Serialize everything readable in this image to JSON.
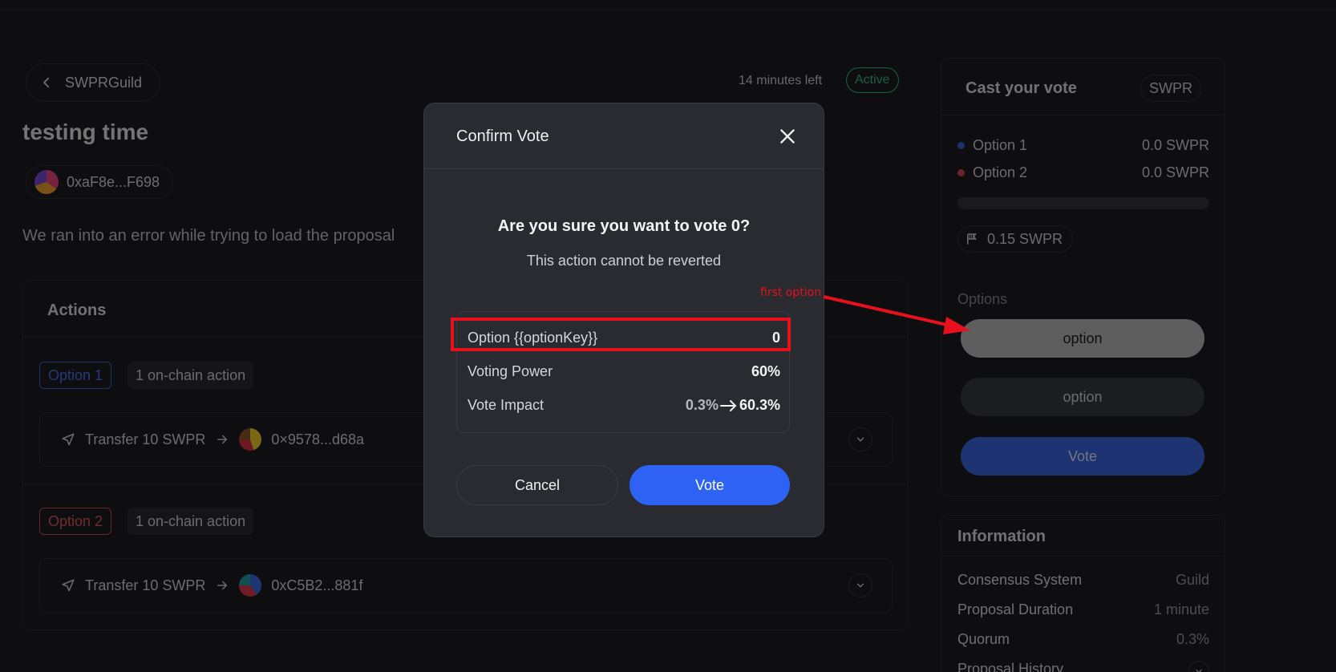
{
  "header": {
    "back_label": "SWPRGuild",
    "time_left": "14 minutes left",
    "status": "Active"
  },
  "proposal": {
    "title": "testing time",
    "author": "0xaF8e...F698",
    "error": "We ran into an error while trying to load the proposal"
  },
  "actions": {
    "title": "Actions",
    "groups": [
      {
        "option": "Option 1",
        "count": "1 on-chain action",
        "action": "Transfer 10 SWPR",
        "recipient": "0×9578...d68a"
      },
      {
        "option": "Option 2",
        "count": "1 on-chain action",
        "action": "Transfer 10 SWPR",
        "recipient": "0xC5B2...881f"
      }
    ]
  },
  "vote_panel": {
    "title": "Cast your vote",
    "token": "SWPR",
    "results": [
      {
        "label": "Option 1",
        "value": "0.0 SWPR",
        "color": "#3b62d6"
      },
      {
        "label": "Option 2",
        "value": "0.0 SWPR",
        "color": "#d24b55"
      }
    ],
    "progress": 0,
    "quorum": "0.15 SWPR",
    "options_label": "Options",
    "option_buttons": [
      "option",
      "option"
    ],
    "vote_label": "Vote"
  },
  "info": {
    "title": "Information",
    "rows": [
      {
        "key": "Consensus System",
        "value": "Guild"
      },
      {
        "key": "Proposal Duration",
        "value": "1 minute"
      },
      {
        "key": "Quorum",
        "value": "0.3%"
      },
      {
        "key": "Proposal History",
        "value": ""
      }
    ]
  },
  "modal": {
    "title": "Confirm Vote",
    "question": "Are you sure you want to vote 0?",
    "subtitle": "This action cannot be reverted",
    "summary": {
      "option_key": "Option {{optionKey}}",
      "option_value": "0",
      "power_key": "Voting Power",
      "power_value": "60%",
      "impact_key": "Vote Impact",
      "impact_before": "0.3%",
      "impact_after": "60.3%"
    },
    "cancel_label": "Cancel",
    "confirm_label": "Vote"
  },
  "annotation": {
    "label": "first option",
    "color": "#e8101c"
  }
}
